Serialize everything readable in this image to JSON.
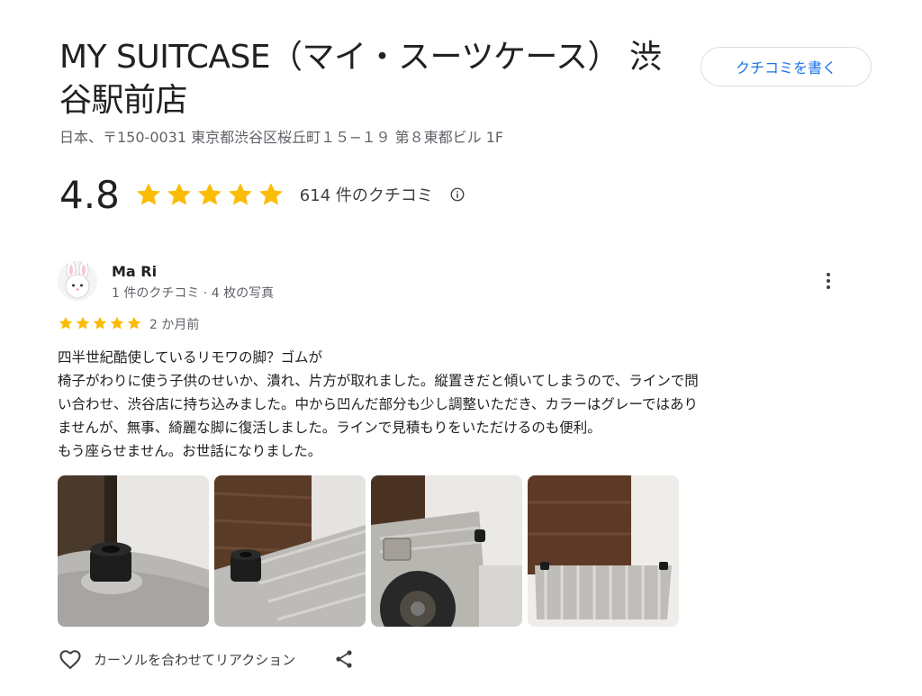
{
  "place": {
    "title": "MY SUITCASE（マイ・スーツケース） 渋谷駅前店",
    "address": "日本、〒150-0031 東京都渋谷区桜丘町１５−１９ 第８東都ビル 1F",
    "write_review_label": "クチコミを書く"
  },
  "rating": {
    "value": "4.8",
    "stars": 5,
    "count_label": "614 件のクチコミ",
    "star_color": "#fbbc04"
  },
  "review": {
    "author": "Ma Ri",
    "meta": "1 件のクチコミ · 4 枚の写真",
    "stars": 5,
    "date": "2 か月前",
    "text_lines": [
      "四半世紀酷使しているリモワの脚？ゴムが",
      "椅子がわりに使う子供のせいか、潰れ、片方が取れました。縦置きだと傾いてしまうので、ラインで問",
      "い合わせ、渋谷店に持ち込みました。中から凹んだ部分も少し調整いただき、カラーはグレーではあり",
      "ませんが、無事、綺麗な脚に復活しました。ラインで見積もりをいただけるのも便利。",
      "もう座らせません。お世話になりました。"
    ],
    "photo_count": 4
  },
  "actions": {
    "react_label": "カーソルを合わせてリアクション"
  },
  "colors": {
    "accent": "#1a73e8",
    "star": "#fbbc04",
    "secondary_text": "#5f6368"
  },
  "icons": [
    "info-icon",
    "more-vert-icon",
    "heart-icon",
    "share-icon",
    "star-icon"
  ]
}
